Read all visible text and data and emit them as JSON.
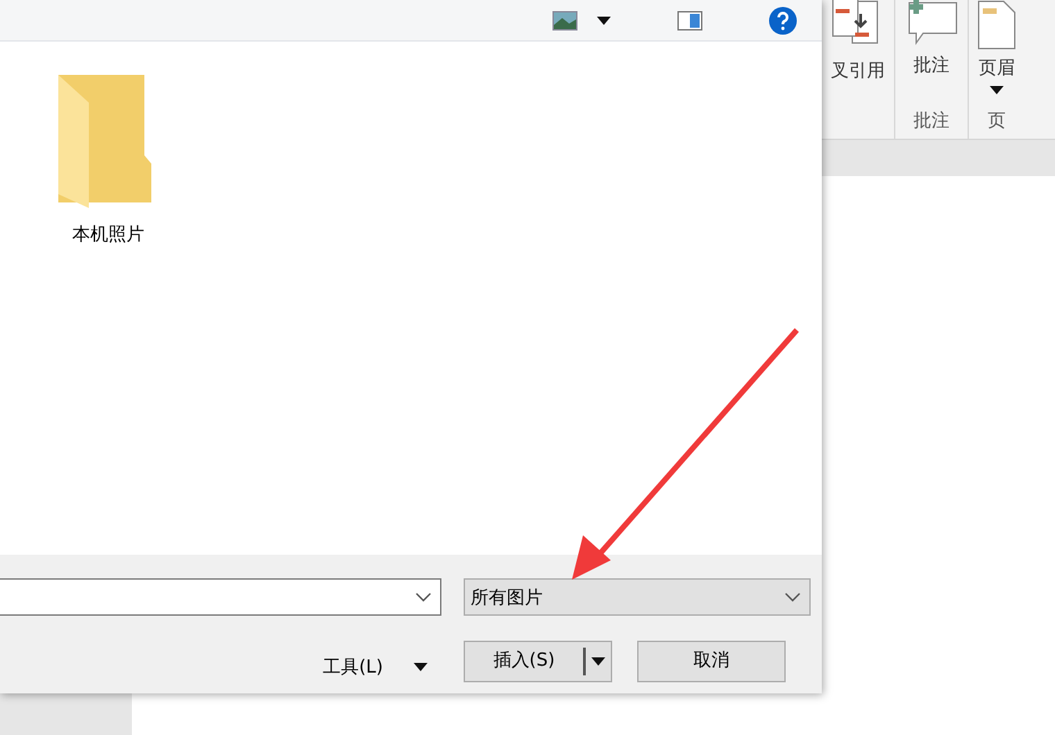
{
  "ribbon": {
    "buttons": [
      {
        "label": "叉引用",
        "kind": "crossref"
      },
      {
        "label": "批注",
        "kind": "comment"
      },
      {
        "label": "页眉",
        "kind": "header"
      }
    ],
    "groups": [
      {
        "label": "批注"
      },
      {
        "label": "页"
      }
    ]
  },
  "dialog": {
    "items": [
      {
        "label": "本机照片"
      }
    ],
    "file_type": {
      "value": "所有图片"
    },
    "tools": {
      "label": "工具(L)"
    },
    "insert": {
      "label": "插入(S)"
    },
    "cancel": {
      "label": "取消"
    }
  }
}
